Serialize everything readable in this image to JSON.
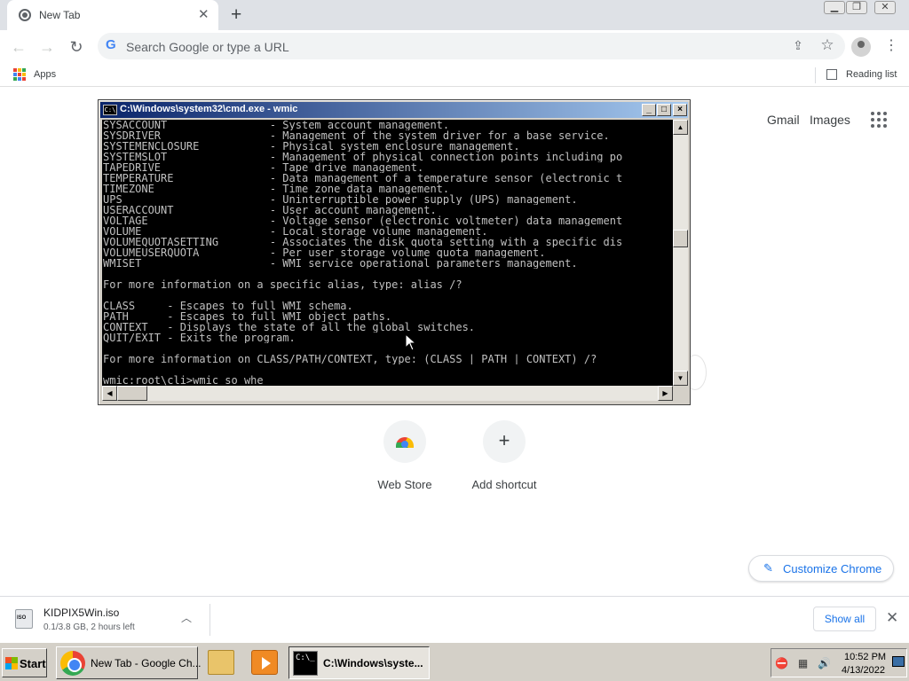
{
  "browser": {
    "tab": {
      "title": "New Tab",
      "close_glyph": "✕"
    },
    "new_tab_glyph": "+",
    "window_controls": [
      "▁",
      "❐",
      "✕"
    ],
    "nav": {
      "back": "←",
      "forward": "→",
      "reload": "↻"
    },
    "omnibox": {
      "placeholder": "Search Google or type a URL",
      "g_glyph": "G"
    },
    "menu_glyph": "⋮",
    "bookmarks": {
      "apps_label": "Apps",
      "reading_list_label": "Reading list"
    }
  },
  "ntp": {
    "gmail": "Gmail",
    "images": "Images",
    "shortcuts": [
      {
        "label": "Web Store"
      },
      {
        "label": "Add shortcut",
        "glyph": "+"
      }
    ],
    "customize_label": "Customize Chrome",
    "customize_glyph": "✎"
  },
  "cmd": {
    "title": "C:\\Windows\\system32\\cmd.exe - wmic",
    "icon_text": "C:\\",
    "controls": [
      "_",
      "□",
      "×"
    ],
    "scroll_glyphs": {
      "up": "▲",
      "down": "▼",
      "left": "◀",
      "right": "▶"
    },
    "lines": [
      "SYSACCOUNT                - System account management.",
      "SYSDRIVER                 - Management of the system driver for a base service.",
      "SYSTEMENCLOSURE           - Physical system enclosure management.",
      "SYSTEMSLOT                - Management of physical connection points including po",
      "TAPEDRIVE                 - Tape drive management.",
      "TEMPERATURE               - Data management of a temperature sensor (electronic t",
      "TIMEZONE                  - Time zone data management.",
      "UPS                       - Uninterruptible power supply (UPS) management.",
      "USERACCOUNT               - User account management.",
      "VOLTAGE                   - Voltage sensor (electronic voltmeter) data management",
      "VOLUME                    - Local storage volume management.",
      "VOLUMEQUOTASETTING        - Associates the disk quota setting with a specific dis",
      "VOLUMEUSERQUOTA           - Per user storage volume quota management.",
      "WMISET                    - WMI service operational parameters management.",
      "",
      "For more information on a specific alias, type: alias /?",
      "",
      "CLASS     - Escapes to full WMI schema.",
      "PATH      - Escapes to full WMI object paths.",
      "CONTEXT   - Displays the state of all the global switches.",
      "QUIT/EXIT - Exits the program.",
      "",
      "For more information on CLASS/PATH/CONTEXT, type: (CLASS | PATH | CONTEXT) /?",
      "",
      "wmic:root\\cli>wmic so whe"
    ]
  },
  "download": {
    "filename": "KIDPIX5Win.iso",
    "status": "0.1/3.8 GB, 2 hours left",
    "chevron": "︿",
    "show_all": "Show all",
    "close_glyph": "✕"
  },
  "taskbar": {
    "start_label": "Start",
    "buttons": [
      {
        "label": "New Tab - Google Ch..."
      },
      {
        "label": "C:\\Windows\\syste...",
        "icon_text": "C:\\_"
      }
    ],
    "clock_time": "10:52 PM",
    "clock_date": "4/13/2022",
    "tray_glyphs": [
      "⛔",
      "▦",
      "🔊"
    ]
  },
  "colors": {
    "tab_strip": "#dee1e6",
    "accent_blue": "#1a73e8",
    "cmd_titlebar": "#0a246a",
    "taskbar": "#d4d0c8"
  }
}
